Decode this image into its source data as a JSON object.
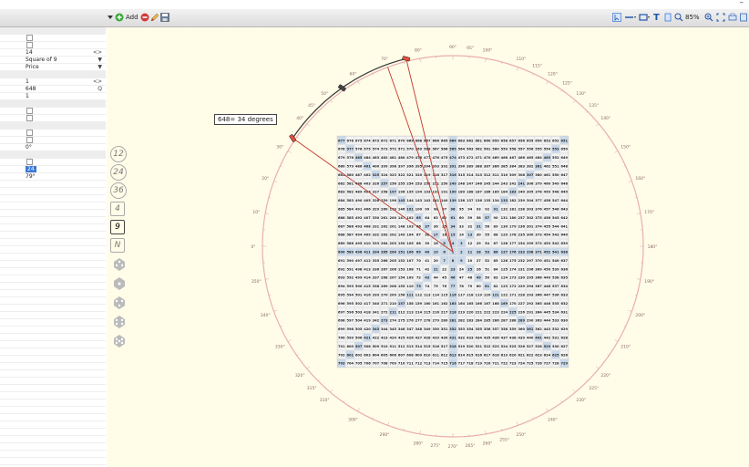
{
  "toolbar": {
    "add_label": "Add",
    "zoom_label": "85%",
    "icons": [
      "add-icon",
      "delete-icon",
      "pencil-icon",
      "save-icon",
      "cursor-icon",
      "line-tool-icon",
      "rect-tool-icon",
      "text-tool-icon",
      "marker-icon",
      "zoom-in-icon",
      "zoom-out-icon",
      "fit-icon"
    ],
    "text_tool_label": "T"
  },
  "properties": {
    "rows": [
      {
        "kind": "header",
        "value": ""
      },
      {
        "kind": "check",
        "value": ""
      },
      {
        "kind": "check",
        "value": ""
      },
      {
        "kind": "text",
        "value": "14",
        "arrow": "<>"
      },
      {
        "kind": "text",
        "value": "Square of 9",
        "arrow": "▼"
      },
      {
        "kind": "text",
        "value": "Price",
        "arrow": "▼"
      },
      {
        "kind": "header",
        "value": ""
      },
      {
        "kind": "text",
        "value": "1",
        "arrow": "<>"
      },
      {
        "kind": "text",
        "value": "648",
        "arrow": "Q"
      },
      {
        "kind": "text",
        "value": "1",
        "arrow": ""
      },
      {
        "kind": "header",
        "value": ""
      },
      {
        "kind": "check",
        "value": ""
      },
      {
        "kind": "check",
        "value": ""
      },
      {
        "kind": "header",
        "value": ""
      },
      {
        "kind": "check",
        "value": ""
      },
      {
        "kind": "check",
        "value": ""
      },
      {
        "kind": "text",
        "value": "0°",
        "arrow": ""
      },
      {
        "kind": "header",
        "value": ""
      },
      {
        "kind": "check",
        "value": ""
      },
      {
        "kind": "selected",
        "value": "24",
        "arrow": ""
      },
      {
        "kind": "text",
        "value": "79°",
        "arrow": ""
      }
    ]
  },
  "palette": {
    "items": [
      "12",
      "24",
      "36",
      "4",
      "9",
      "N"
    ]
  },
  "callout": {
    "text": "648= 34 degrees"
  },
  "wheel": {
    "outer_degree_labels": [
      "10°",
      "20°",
      "30°",
      "40°",
      "45°",
      "50°",
      "60°",
      "70°",
      "80°",
      "90°",
      "95°",
      "100°",
      "110°",
      "115°",
      "120°",
      "125°",
      "130°",
      "135°",
      "140°",
      "150°",
      "160°",
      "170°",
      "180°",
      "190°",
      "200°",
      "210°",
      "220°",
      "225°",
      "230°",
      "240°",
      "250°",
      "255°",
      "260°",
      "265°",
      "270°",
      "275°",
      "280°",
      "290°",
      "300°",
      "310°",
      "315°",
      "320°",
      "330°",
      "340°",
      "350°",
      "0°"
    ],
    "grid_corner_top_left": "651",
    "grid_corner_bottom_left": "729",
    "grid_corner_bottom_right": "703",
    "grid_center": "1"
  },
  "colors": {
    "canvas_bg": "#fffce8",
    "grid_cell": "#f3f3f3",
    "grid_highlight": "#c9d9ea",
    "line_red": "#c0392b",
    "selection_blue": "#3b78d8"
  }
}
